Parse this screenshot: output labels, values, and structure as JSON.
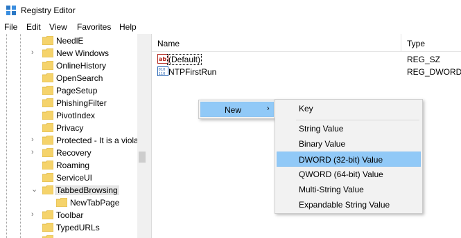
{
  "window": {
    "title": "Registry Editor"
  },
  "menubar": {
    "items": [
      "File",
      "Edit",
      "View",
      "Favorites",
      "Help"
    ]
  },
  "tree": {
    "items": [
      {
        "label": "NeedlE",
        "expander": ""
      },
      {
        "label": "New Windows",
        "expander": "›"
      },
      {
        "label": "OnlineHistory",
        "expander": ""
      },
      {
        "label": "OpenSearch",
        "expander": ""
      },
      {
        "label": "PageSetup",
        "expander": ""
      },
      {
        "label": "PhishingFilter",
        "expander": ""
      },
      {
        "label": "PivotIndex",
        "expander": ""
      },
      {
        "label": "Privacy",
        "expander": ""
      },
      {
        "label": "Protected - It is a viola",
        "expander": "›"
      },
      {
        "label": "Recovery",
        "expander": "›"
      },
      {
        "label": "Roaming",
        "expander": ""
      },
      {
        "label": "ServiceUI",
        "expander": ""
      },
      {
        "label": "TabbedBrowsing",
        "expander": "⌄"
      },
      {
        "label": "NewTabPage",
        "expander": ""
      },
      {
        "label": "Toolbar",
        "expander": "›"
      },
      {
        "label": "TypedURLs",
        "expander": ""
      }
    ]
  },
  "list": {
    "columns": [
      "Name",
      "Type"
    ],
    "rows": [
      {
        "icon": "string-value-icon",
        "name": "(Default)",
        "type": "REG_SZ"
      },
      {
        "icon": "binary-value-icon",
        "name": "NTPFirstRun",
        "type": "REG_DWORD"
      }
    ]
  },
  "context_menu": {
    "new_label": "New"
  },
  "submenu": {
    "items": [
      "Key",
      "String Value",
      "Binary Value",
      "DWORD (32-bit) Value",
      "QWORD (64-bit) Value",
      "Multi-String Value",
      "Expandable String Value"
    ],
    "highlighted": "DWORD (32-bit) Value"
  },
  "colors": {
    "folder": "#f5d36b",
    "highlight": "#91c9f7",
    "menu_bg": "#f2f2f2"
  }
}
